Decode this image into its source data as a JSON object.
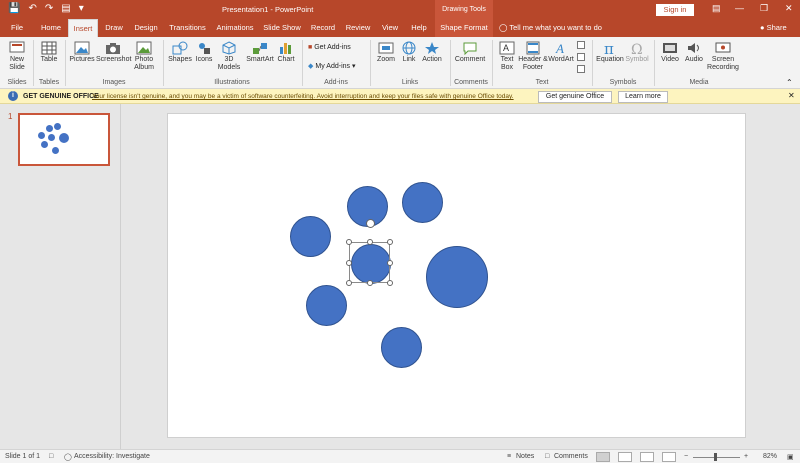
{
  "window": {
    "title": "Presentation1 - PowerPoint",
    "contextual_header": "Drawing Tools",
    "signin_label": "Sign in",
    "accent": "#b7472a"
  },
  "qat": {
    "save_icon": "save-icon",
    "undo_icon": "undo-icon",
    "redo_icon": "redo-icon",
    "present_icon": "present-icon"
  },
  "tabs": [
    "File",
    "Home",
    "Insert",
    "Draw",
    "Design",
    "Transitions",
    "Animations",
    "Slide Show",
    "Record",
    "Review",
    "View",
    "Help",
    "Shape Format"
  ],
  "active_tab": "Insert",
  "tell_me": "Tell me what you want to do",
  "share": "Share",
  "ribbon": {
    "new_slide": "New Slide",
    "table": "Table",
    "pictures": "Pictures",
    "screenshot": "Screenshot",
    "photo_album": "Photo Album",
    "shapes": "Shapes",
    "icons": "Icons",
    "models_3d": "3D Models",
    "smartart": "SmartArt",
    "chart": "Chart",
    "get_addins": "Get Add-ins",
    "my_addins": "My Add-ins",
    "zoom": "Zoom",
    "link": "Link",
    "action": "Action",
    "comment": "Comment",
    "text_box": "Text Box",
    "header_footer": "Header & Footer",
    "wordart": "WordArt",
    "equation": "Equation",
    "symbol": "Symbol",
    "video": "Video",
    "audio": "Audio",
    "screen_recording": "Screen Recording",
    "groups": {
      "slides": "Slides",
      "tables": "Tables",
      "images": "Images",
      "illustrations": "Illustrations",
      "addins": "Add-ins",
      "links": "Links",
      "comments": "Comments",
      "text": "Text",
      "symbols": "Symbols",
      "media": "Media"
    }
  },
  "infobar": {
    "title": "GET GENUINE OFFICE",
    "message": "Your license isn't genuine, and you may be a victim of software counterfeiting. Avoid interruption and keep your files safe with genuine Office today.",
    "primary_button": "Get genuine Office",
    "secondary_button": "Learn more"
  },
  "thumbnails": [
    {
      "number": "1"
    }
  ],
  "shape_color": "#4472c4",
  "status": {
    "slide_counter": "Slide 1 of 1",
    "accessibility": "Accessibility: Investigate",
    "notes": "Notes",
    "comments": "Comments",
    "zoom_level": "82%"
  }
}
